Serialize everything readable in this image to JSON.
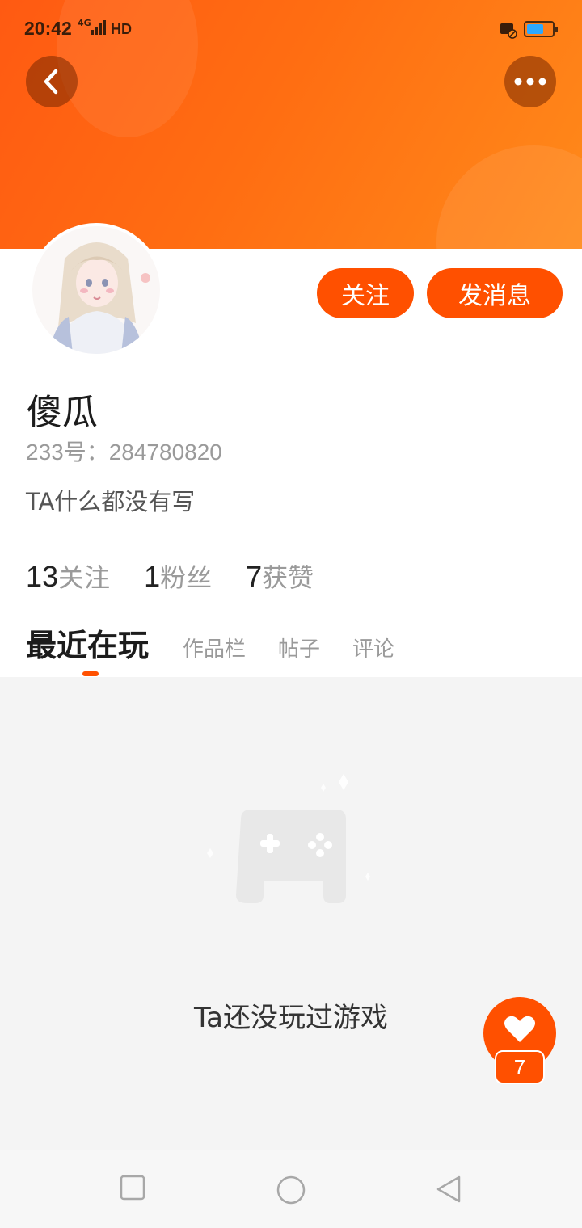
{
  "status_bar": {
    "time": "20:42",
    "network": "4G",
    "hd": "HD"
  },
  "header": {
    "back_icon": "chevron-left-icon",
    "more_icon": "more-horizontal-icon"
  },
  "profile": {
    "follow_label": "关注",
    "message_label": "发消息",
    "username": "傻瓜",
    "user_id": "233号：284780820",
    "bio": "TA什么都没有写",
    "stats": [
      {
        "value": "13",
        "label": "关注"
      },
      {
        "value": "1",
        "label": "粉丝"
      },
      {
        "value": "7",
        "label": "获赞"
      }
    ]
  },
  "tabs": [
    {
      "label": "最近在玩",
      "active": true
    },
    {
      "label": "作品栏",
      "active": false
    },
    {
      "label": "帖子",
      "active": false
    },
    {
      "label": "评论",
      "active": false
    }
  ],
  "content": {
    "empty_text": "Ta还没玩过游戏",
    "empty_icon": "gamepad-icon"
  },
  "like": {
    "count": "7",
    "icon": "heart-icon"
  },
  "nav": {
    "recent_icon": "square-icon",
    "home_icon": "circle-icon",
    "back_icon": "triangle-back-icon"
  },
  "colors": {
    "accent": "#ff5000",
    "header_start": "#ff5a12",
    "header_end": "#ff8a1a"
  }
}
